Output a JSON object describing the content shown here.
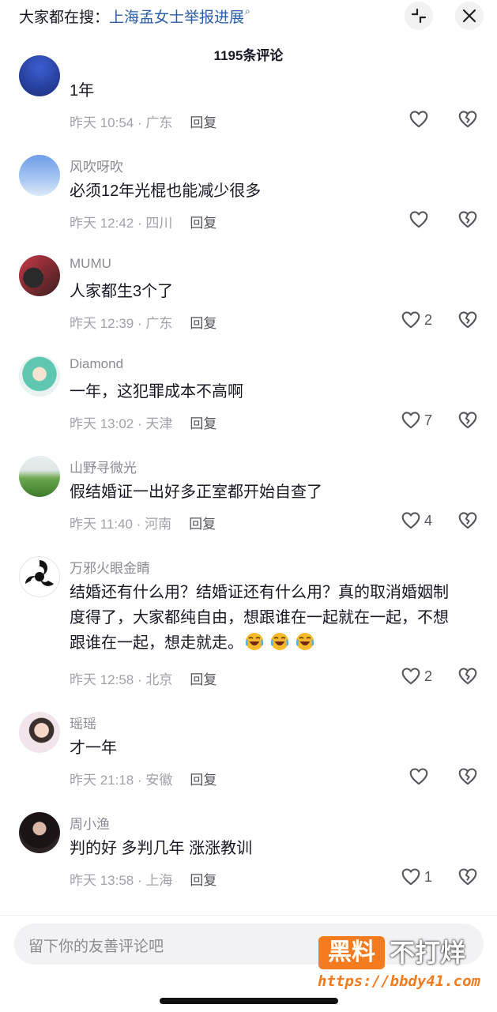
{
  "header": {
    "search_prefix": "大家都在搜：",
    "search_link": "上海孟女士举报进展",
    "comment_count": "1195条评论"
  },
  "reply_label": "回复",
  "comments": [
    {
      "username": "",
      "text": "1年",
      "time": "昨天 10:54",
      "location": "广东",
      "likes": ""
    },
    {
      "username": "风吹呀吹",
      "text": "必须12年光棍也能减少很多",
      "time": "昨天 12:42",
      "location": "四川",
      "likes": ""
    },
    {
      "username": "MUMU",
      "text": "人家都生3个了",
      "time": "昨天 12:39",
      "location": "广东",
      "likes": "2"
    },
    {
      "username": "Diamond",
      "text": "一年，这犯罪成本不高啊",
      "time": "昨天 13:02",
      "location": "天津",
      "likes": "7"
    },
    {
      "username": "山野寻微光",
      "text": "假结婚证一出好多正室都开始自查了",
      "time": "昨天 11:40",
      "location": "河南",
      "likes": "4"
    },
    {
      "username": "万邪火眼金睛",
      "text": "结婚还有什么用？结婚证还有什么用？真的取消婚姻制度得了，大家都纯自由，想跟谁在一起就在一起，不想跟谁在一起，想走就走。",
      "time": "昨天 12:58",
      "location": "北京",
      "likes": "2"
    },
    {
      "username": "瑶瑶",
      "text": "才一年",
      "time": "昨天 21:18",
      "location": "安徽",
      "likes": ""
    },
    {
      "username": "周小渔",
      "text": "判的好 多判几年 涨涨教训",
      "time": "昨天 13:58",
      "location": "上海",
      "likes": "1"
    }
  ],
  "input": {
    "placeholder": "留下你的友善评论吧"
  },
  "watermark": {
    "brand": "黑料",
    "slogan": "不打烊",
    "url": "https://bbdy41.com"
  },
  "icons": {
    "collapse": "collapse-icon",
    "close": "close-icon",
    "like": "heart-outline-icon",
    "dislike": "broken-heart-icon",
    "emoji": "crying-laughing-emoji"
  },
  "colors": {
    "link": "#2a5ca8",
    "text": "#161823",
    "muted": "#a1a2a7",
    "watermark": "#f47b1e"
  }
}
